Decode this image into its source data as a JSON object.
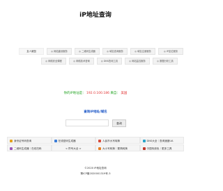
{
  "header": {
    "title": "iP地址查询"
  },
  "nav": {
    "rows": [
      [
        "友人家园",
        "网站建设服务",
        "二维码生成器",
        "域名查询服务",
        "域名注册服务",
        "IP定位服务"
      ],
      [
        "网络安全课程",
        "网络技术咨询",
        "DNS查询工具",
        "网站监控服务",
        "数据分析工具"
      ]
    ]
  },
  "ip_info": {
    "label": "你的iP地址是：",
    "ip": "192.0.100.186",
    "location_label": "来自：",
    "location": "美国"
  },
  "query": {
    "title": "查询IP地址/域名",
    "input_value": "",
    "button_label": "查询"
  },
  "links": {
    "rows": [
      [
        {
          "text": "身份证号码查询",
          "icon_color": "#e4a11b"
        },
        {
          "text": "在线密码生成器",
          "icon_color": "#3b7dd8"
        },
        {
          "text": "人民币大写转换",
          "icon_color": "#d84a3b"
        },
        {
          "text": "DNS大全｜查询速度UA",
          "icon_color": "#2aa4c9"
        }
      ],
      [
        {
          "text": "二维码生成器｜在线扫码",
          "icon_color": "#9b59b6"
        },
        {
          "text": "< 符号大全 >",
          "icon_color": ""
        },
        {
          "text": "大小写转换｜繁简转换",
          "icon_color": "#e67e22"
        },
        {
          "text": "中国传统色｜更多工具",
          "icon_color": "#c0392b"
        }
      ]
    ]
  },
  "footer": {
    "line1": "©2020 iP地址查询",
    "line2": "豫ICP备2020001319号-3"
  }
}
